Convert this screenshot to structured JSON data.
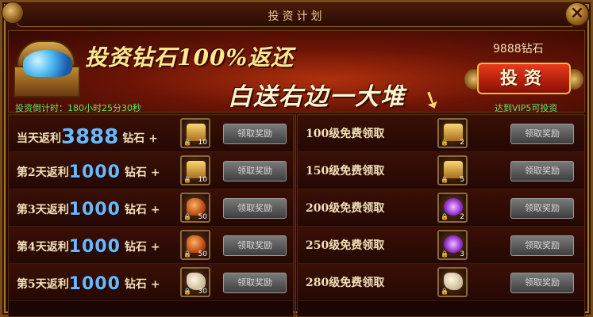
{
  "window": {
    "title": "投资计划",
    "close_symbol": "×"
  },
  "banner": {
    "headline": "投资钻石100%返还",
    "subline": "白送右边一大堆",
    "timer_label": "投资倒计时：",
    "timer_value": "180小时25分30秒",
    "cost": "9888钻石",
    "invest_label": "投资",
    "vip_note": "达到VIP5可投资"
  },
  "left_rows": [
    {
      "prefix": "当天返利",
      "amount": "3888",
      "suffix": "钻石 +",
      "qty": "10",
      "item": "gold",
      "button": "领取奖励"
    },
    {
      "prefix": "第2天返利",
      "amount": "1000",
      "suffix": "钻石 +",
      "qty": "10",
      "item": "gold",
      "button": "领取奖励"
    },
    {
      "prefix": "第3天返利",
      "amount": "1000",
      "suffix": "钻石 +",
      "qty": "50",
      "item": "orange",
      "button": "领取奖励"
    },
    {
      "prefix": "第4天返利",
      "amount": "1000",
      "suffix": "钻石 +",
      "qty": "50",
      "item": "orange",
      "button": "领取奖励"
    },
    {
      "prefix": "第5天返利",
      "amount": "1000",
      "suffix": "钻石 +",
      "qty": "30",
      "item": "pale",
      "button": "领取奖励"
    }
  ],
  "right_rows": [
    {
      "label": "100级免费领取",
      "qty": "2",
      "item": "gold",
      "button": "领取奖励"
    },
    {
      "label": "150级免费领取",
      "qty": "5",
      "item": "gold",
      "button": "领取奖励"
    },
    {
      "label": "200级免费领取",
      "qty": "2",
      "item": "purple",
      "button": "领取奖励"
    },
    {
      "label": "250级免费领取",
      "qty": "3",
      "item": "purple",
      "button": "领取奖励"
    },
    {
      "label": "280级免费领取",
      "qty": "",
      "item": "pale",
      "button": "领取奖励"
    }
  ],
  "colors": {
    "accent_green": "#5ee86a",
    "amount_blue": "#6ab8ff",
    "invest_red": "#e83a1a"
  }
}
